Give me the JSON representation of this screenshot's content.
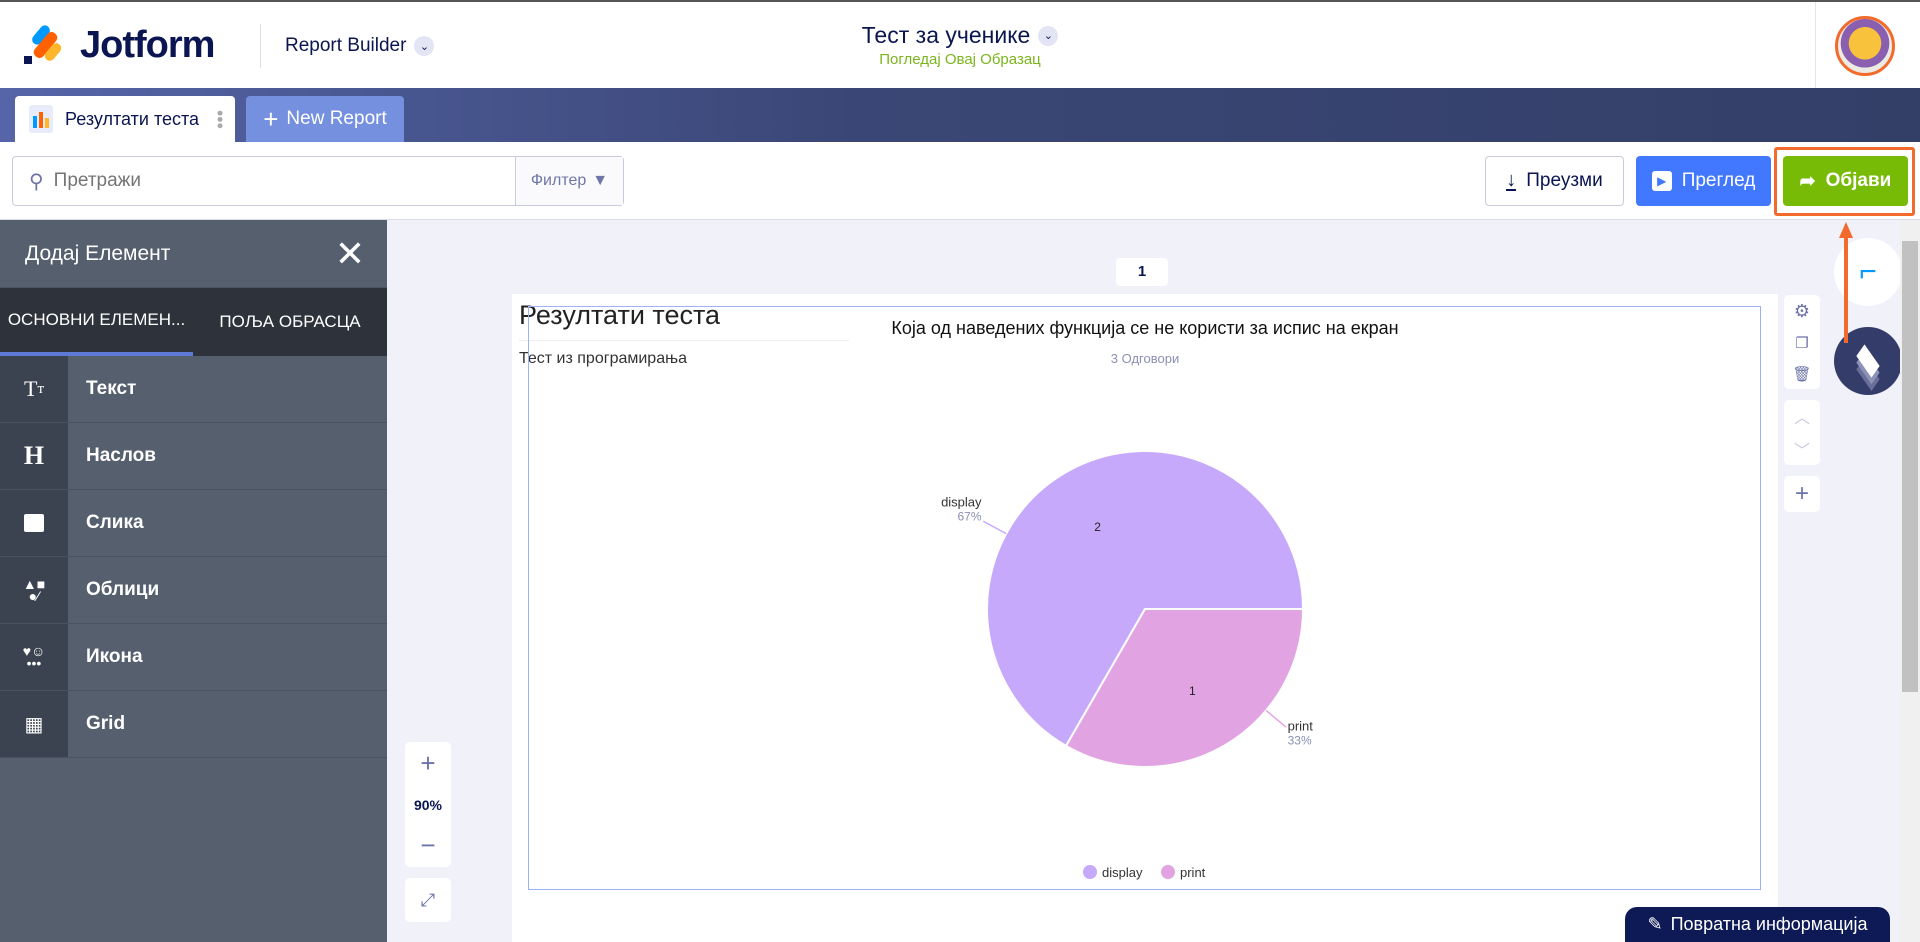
{
  "header": {
    "logo": "Jotform",
    "app_name": "Report Builder",
    "form_title": "Тест за ученике",
    "form_link": "Погледај Овај Образац"
  },
  "tabs": [
    {
      "label": "Резултати теста"
    },
    {
      "label": "New Report"
    }
  ],
  "toolbar": {
    "search_placeholder": "Претражи",
    "filter_label": "Филтер",
    "download_label": "Преузми",
    "preview_label": "Преглед",
    "publish_label": "Објави"
  },
  "sidebar": {
    "title": "Додај Елемент",
    "tabs": [
      "ОСНОВНИ ЕЛЕМЕН...",
      "ПОЉА ОБРАСЦА"
    ],
    "items": [
      {
        "icon": "Tт",
        "label": "Текст"
      },
      {
        "icon": "H",
        "label": "Наслов"
      },
      {
        "icon": "image-icon",
        "label": "Слика"
      },
      {
        "icon": "shapes-icon",
        "label": "Облици"
      },
      {
        "icon": "icon-icon",
        "label": "Икона"
      },
      {
        "icon": "grid-icon",
        "label": "Grid"
      }
    ]
  },
  "canvas": {
    "page_number": "1",
    "zoom": "90%"
  },
  "report": {
    "title": "Резултати теста",
    "subtitle": "Тест из програмирања"
  },
  "chart_data": {
    "type": "pie",
    "title": "Која од наведених функција се не користи за испис на екран",
    "subtitle": "3 Одговори",
    "categories": [
      "display",
      "print"
    ],
    "values": [
      2,
      1
    ],
    "percent_labels": [
      "67%",
      "33%"
    ],
    "colors": [
      "#c6a9fb",
      "#e2a3e2"
    ],
    "legend": "bottom"
  },
  "feedback_label": "Повратна информација",
  "colors": {
    "publish": "#78bb07",
    "preview": "#4277ff",
    "highlight": "#f26b2d"
  }
}
